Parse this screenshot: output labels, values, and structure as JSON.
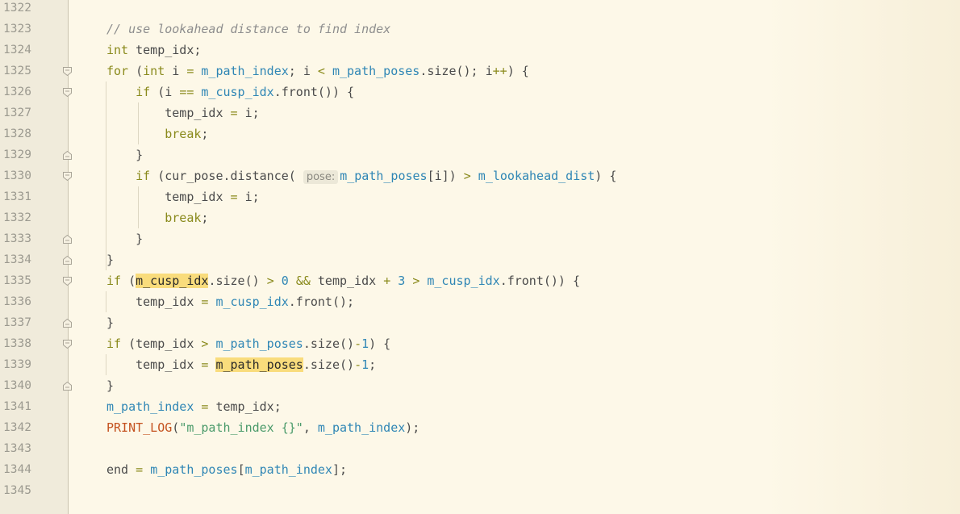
{
  "editor": {
    "lines": [
      {
        "num": "1322",
        "fold": "",
        "tokens": []
      },
      {
        "num": "1323",
        "fold": "",
        "tokens": [
          {
            "t": "cmt",
            "v": "// use lookahead distance to find index"
          }
        ]
      },
      {
        "num": "1324",
        "fold": "",
        "tokens": [
          {
            "t": "kw",
            "v": "int"
          },
          {
            "t": "fn",
            "v": " temp_idx;"
          }
        ]
      },
      {
        "num": "1325",
        "fold": "open",
        "tokens": [
          {
            "t": "kw",
            "v": "for"
          },
          {
            "t": "fn",
            "v": " ("
          },
          {
            "t": "kw",
            "v": "int"
          },
          {
            "t": "fn",
            "v": " i "
          },
          {
            "t": "op",
            "v": "="
          },
          {
            "t": "fn",
            "v": " "
          },
          {
            "t": "fld",
            "v": "m_path_index"
          },
          {
            "t": "fn",
            "v": "; i "
          },
          {
            "t": "op",
            "v": "<"
          },
          {
            "t": "fn",
            "v": " "
          },
          {
            "t": "fld",
            "v": "m_path_poses"
          },
          {
            "t": "fn",
            "v": ".size(); i"
          },
          {
            "t": "op",
            "v": "++"
          },
          {
            "t": "fn",
            "v": ") {"
          }
        ]
      },
      {
        "num": "1326",
        "fold": "open",
        "tokens": [
          {
            "t": "fn",
            "v": "    "
          },
          {
            "t": "kw",
            "v": "if"
          },
          {
            "t": "fn",
            "v": " (i "
          },
          {
            "t": "op",
            "v": "=="
          },
          {
            "t": "fn",
            "v": " "
          },
          {
            "t": "fld",
            "v": "m_cusp_idx"
          },
          {
            "t": "fn",
            "v": ".front()) {"
          }
        ]
      },
      {
        "num": "1327",
        "fold": "",
        "tokens": [
          {
            "t": "fn",
            "v": "        temp_idx "
          },
          {
            "t": "op",
            "v": "="
          },
          {
            "t": "fn",
            "v": " i;"
          }
        ]
      },
      {
        "num": "1328",
        "fold": "",
        "tokens": [
          {
            "t": "fn",
            "v": "        "
          },
          {
            "t": "kw",
            "v": "break"
          },
          {
            "t": "fn",
            "v": ";"
          }
        ]
      },
      {
        "num": "1329",
        "fold": "close",
        "tokens": [
          {
            "t": "fn",
            "v": "    }"
          }
        ]
      },
      {
        "num": "1330",
        "fold": "open",
        "tokens": [
          {
            "t": "fn",
            "v": "    "
          },
          {
            "t": "kw",
            "v": "if"
          },
          {
            "t": "fn",
            "v": " (cur_pose.distance( "
          },
          {
            "t": "hint",
            "v": "pose:"
          },
          {
            "t": "fld",
            "v": "m_path_poses"
          },
          {
            "t": "fn",
            "v": "[i]) "
          },
          {
            "t": "op",
            "v": ">"
          },
          {
            "t": "fn",
            "v": " "
          },
          {
            "t": "fld",
            "v": "m_lookahead_dist"
          },
          {
            "t": "fn",
            "v": ") {"
          }
        ]
      },
      {
        "num": "1331",
        "fold": "",
        "tokens": [
          {
            "t": "fn",
            "v": "        temp_idx "
          },
          {
            "t": "op",
            "v": "="
          },
          {
            "t": "fn",
            "v": " i;"
          }
        ]
      },
      {
        "num": "1332",
        "fold": "",
        "tokens": [
          {
            "t": "fn",
            "v": "        "
          },
          {
            "t": "kw",
            "v": "break"
          },
          {
            "t": "fn",
            "v": ";"
          }
        ]
      },
      {
        "num": "1333",
        "fold": "close",
        "tokens": [
          {
            "t": "fn",
            "v": "    }"
          }
        ]
      },
      {
        "num": "1334",
        "fold": "close",
        "tokens": [
          {
            "t": "fn",
            "v": "}"
          }
        ]
      },
      {
        "num": "1335",
        "fold": "open",
        "tokens": [
          {
            "t": "kw",
            "v": "if"
          },
          {
            "t": "fn",
            "v": " ("
          },
          {
            "t": "hl",
            "v": "m_cusp_idx"
          },
          {
            "t": "fn",
            "v": ".size() "
          },
          {
            "t": "op",
            "v": ">"
          },
          {
            "t": "fn",
            "v": " "
          },
          {
            "t": "num",
            "v": "0"
          },
          {
            "t": "fn",
            "v": " "
          },
          {
            "t": "op",
            "v": "&&"
          },
          {
            "t": "fn",
            "v": " temp_idx "
          },
          {
            "t": "op",
            "v": "+"
          },
          {
            "t": "fn",
            "v": " "
          },
          {
            "t": "num",
            "v": "3"
          },
          {
            "t": "fn",
            "v": " "
          },
          {
            "t": "op",
            "v": ">"
          },
          {
            "t": "fn",
            "v": " "
          },
          {
            "t": "fld",
            "v": "m_cusp_idx"
          },
          {
            "t": "fn",
            "v": ".front()) {"
          }
        ]
      },
      {
        "num": "1336",
        "fold": "",
        "tokens": [
          {
            "t": "fn",
            "v": "    temp_idx "
          },
          {
            "t": "op",
            "v": "="
          },
          {
            "t": "fn",
            "v": " "
          },
          {
            "t": "fld",
            "v": "m_cusp_idx"
          },
          {
            "t": "fn",
            "v": ".front();"
          }
        ]
      },
      {
        "num": "1337",
        "fold": "close",
        "tokens": [
          {
            "t": "fn",
            "v": "}"
          }
        ]
      },
      {
        "num": "1338",
        "fold": "open",
        "tokens": [
          {
            "t": "kw",
            "v": "if"
          },
          {
            "t": "fn",
            "v": " (temp_idx "
          },
          {
            "t": "op",
            "v": ">"
          },
          {
            "t": "fn",
            "v": " "
          },
          {
            "t": "fld",
            "v": "m_path_poses"
          },
          {
            "t": "fn",
            "v": ".size()"
          },
          {
            "t": "op",
            "v": "-"
          },
          {
            "t": "num",
            "v": "1"
          },
          {
            "t": "fn",
            "v": ") {"
          }
        ]
      },
      {
        "num": "1339",
        "fold": "",
        "tokens": [
          {
            "t": "fn",
            "v": "    temp_idx "
          },
          {
            "t": "op",
            "v": "="
          },
          {
            "t": "fn",
            "v": " "
          },
          {
            "t": "hl",
            "v": "m_path_poses"
          },
          {
            "t": "fn",
            "v": ".size()"
          },
          {
            "t": "op",
            "v": "-"
          },
          {
            "t": "num",
            "v": "1"
          },
          {
            "t": "fn",
            "v": ";"
          }
        ]
      },
      {
        "num": "1340",
        "fold": "close",
        "tokens": [
          {
            "t": "fn",
            "v": "}"
          }
        ]
      },
      {
        "num": "1341",
        "fold": "",
        "tokens": [
          {
            "t": "fld",
            "v": "m_path_index"
          },
          {
            "t": "fn",
            "v": " "
          },
          {
            "t": "op",
            "v": "="
          },
          {
            "t": "fn",
            "v": " temp_idx;"
          }
        ]
      },
      {
        "num": "1342",
        "fold": "",
        "tokens": [
          {
            "t": "mac",
            "v": "PRINT_LOG"
          },
          {
            "t": "fn",
            "v": "("
          },
          {
            "t": "str",
            "v": "\"m_path_index {}\""
          },
          {
            "t": "fn",
            "v": ", "
          },
          {
            "t": "fld",
            "v": "m_path_index"
          },
          {
            "t": "fn",
            "v": ");"
          }
        ]
      },
      {
        "num": "1343",
        "fold": "",
        "tokens": []
      },
      {
        "num": "1344",
        "fold": "",
        "tokens": [
          {
            "t": "fn",
            "v": "end "
          },
          {
            "t": "op",
            "v": "="
          },
          {
            "t": "fn",
            "v": " "
          },
          {
            "t": "fld",
            "v": "m_path_poses"
          },
          {
            "t": "fn",
            "v": "["
          },
          {
            "t": "fld",
            "v": "m_path_index"
          },
          {
            "t": "fn",
            "v": "];"
          }
        ]
      },
      {
        "num": "1345",
        "fold": "",
        "tokens": []
      }
    ]
  }
}
